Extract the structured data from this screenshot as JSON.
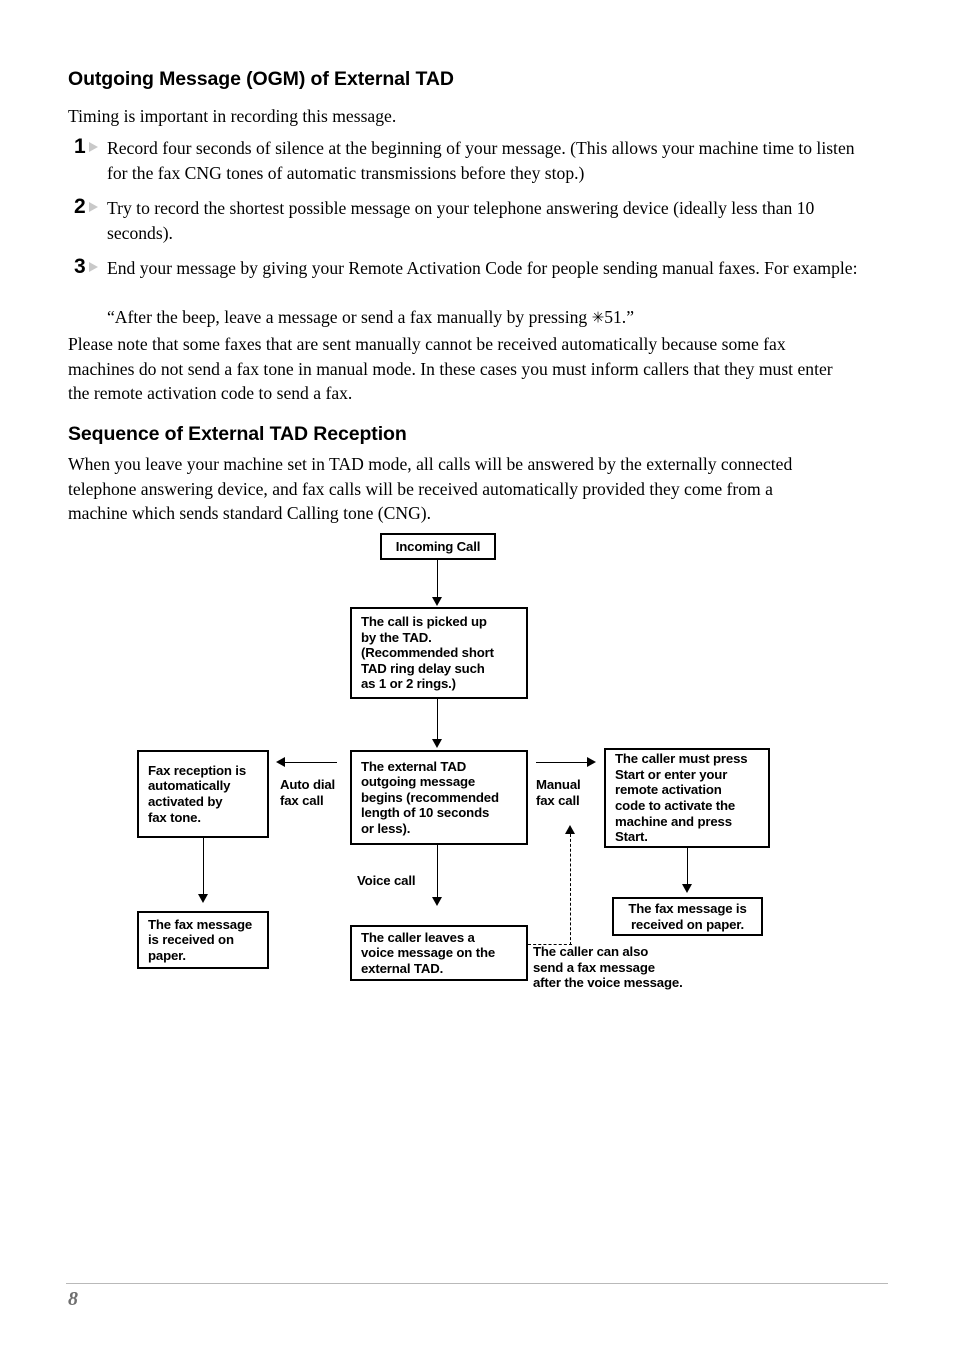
{
  "document": {
    "page_number": "8"
  },
  "section1": {
    "heading": "Outgoing Message (OGM) of External TAD",
    "intro": "Timing is important in recording this message.",
    "steps": [
      {
        "number": "1",
        "text": "Record four seconds of silence at the beginning of your message. (This allows your machine time to listen for the fax CNG tones of automatic transmissions before they stop.)"
      },
      {
        "number": "2",
        "text": "Try to record the shortest possible message on your telephone answering device (ideally less than 10 seconds)."
      },
      {
        "number": "3",
        "text": "End your message by giving your Remote Activation Code for people sending manual faxes. For example:",
        "example_before": "“After the beep, leave a message or send a fax manually by pressing ",
        "example_symbol": "✳",
        "example_after": "51.”"
      }
    ],
    "note": "Please note that some faxes that are sent manually cannot be received automatically because some fax machines do not send a fax tone in manual mode. In these cases you must inform callers that they must enter the remote activation code to send a fax."
  },
  "section2": {
    "heading": "Sequence of External TAD Reception",
    "intro": "When you leave your machine set in TAD mode, all calls will be answered by the externally connected telephone answering device, and fax calls will be received automatically provided they come from a machine which sends standard Calling tone (CNG)."
  },
  "flowchart": {
    "nodes": {
      "incoming_call": "Incoming Call",
      "call_picked_up": "The call is picked up\nby the TAD.\n(Recommended short\nTAD ring delay such\nas 1 or 2 rings.)",
      "fax_reception": "Fax reception is\nautomatically\nactivated by\nfax tone.",
      "external_tad_ogm": "The external TAD\noutgoing message\nbegins (recommended\nlength of 10 seconds\nor less).",
      "caller_must_press_start": "The caller must press\nStart or enter your\nremote activation\ncode to activate the\nmachine and press\nStart.",
      "fax_received_left": "The fax message\nis received on\npaper.",
      "caller_leaves_voice": "The caller leaves a\nvoice message on the\nexternal TAD.",
      "fax_received_right": "The fax message is\nreceived on paper."
    },
    "edge_labels": {
      "auto_dial": "Auto dial\nfax call",
      "manual_fax": "Manual\nfax call",
      "voice_call": "Voice call",
      "caller_can_also": "The caller can also\nsend a fax message\nafter the voice message."
    }
  }
}
